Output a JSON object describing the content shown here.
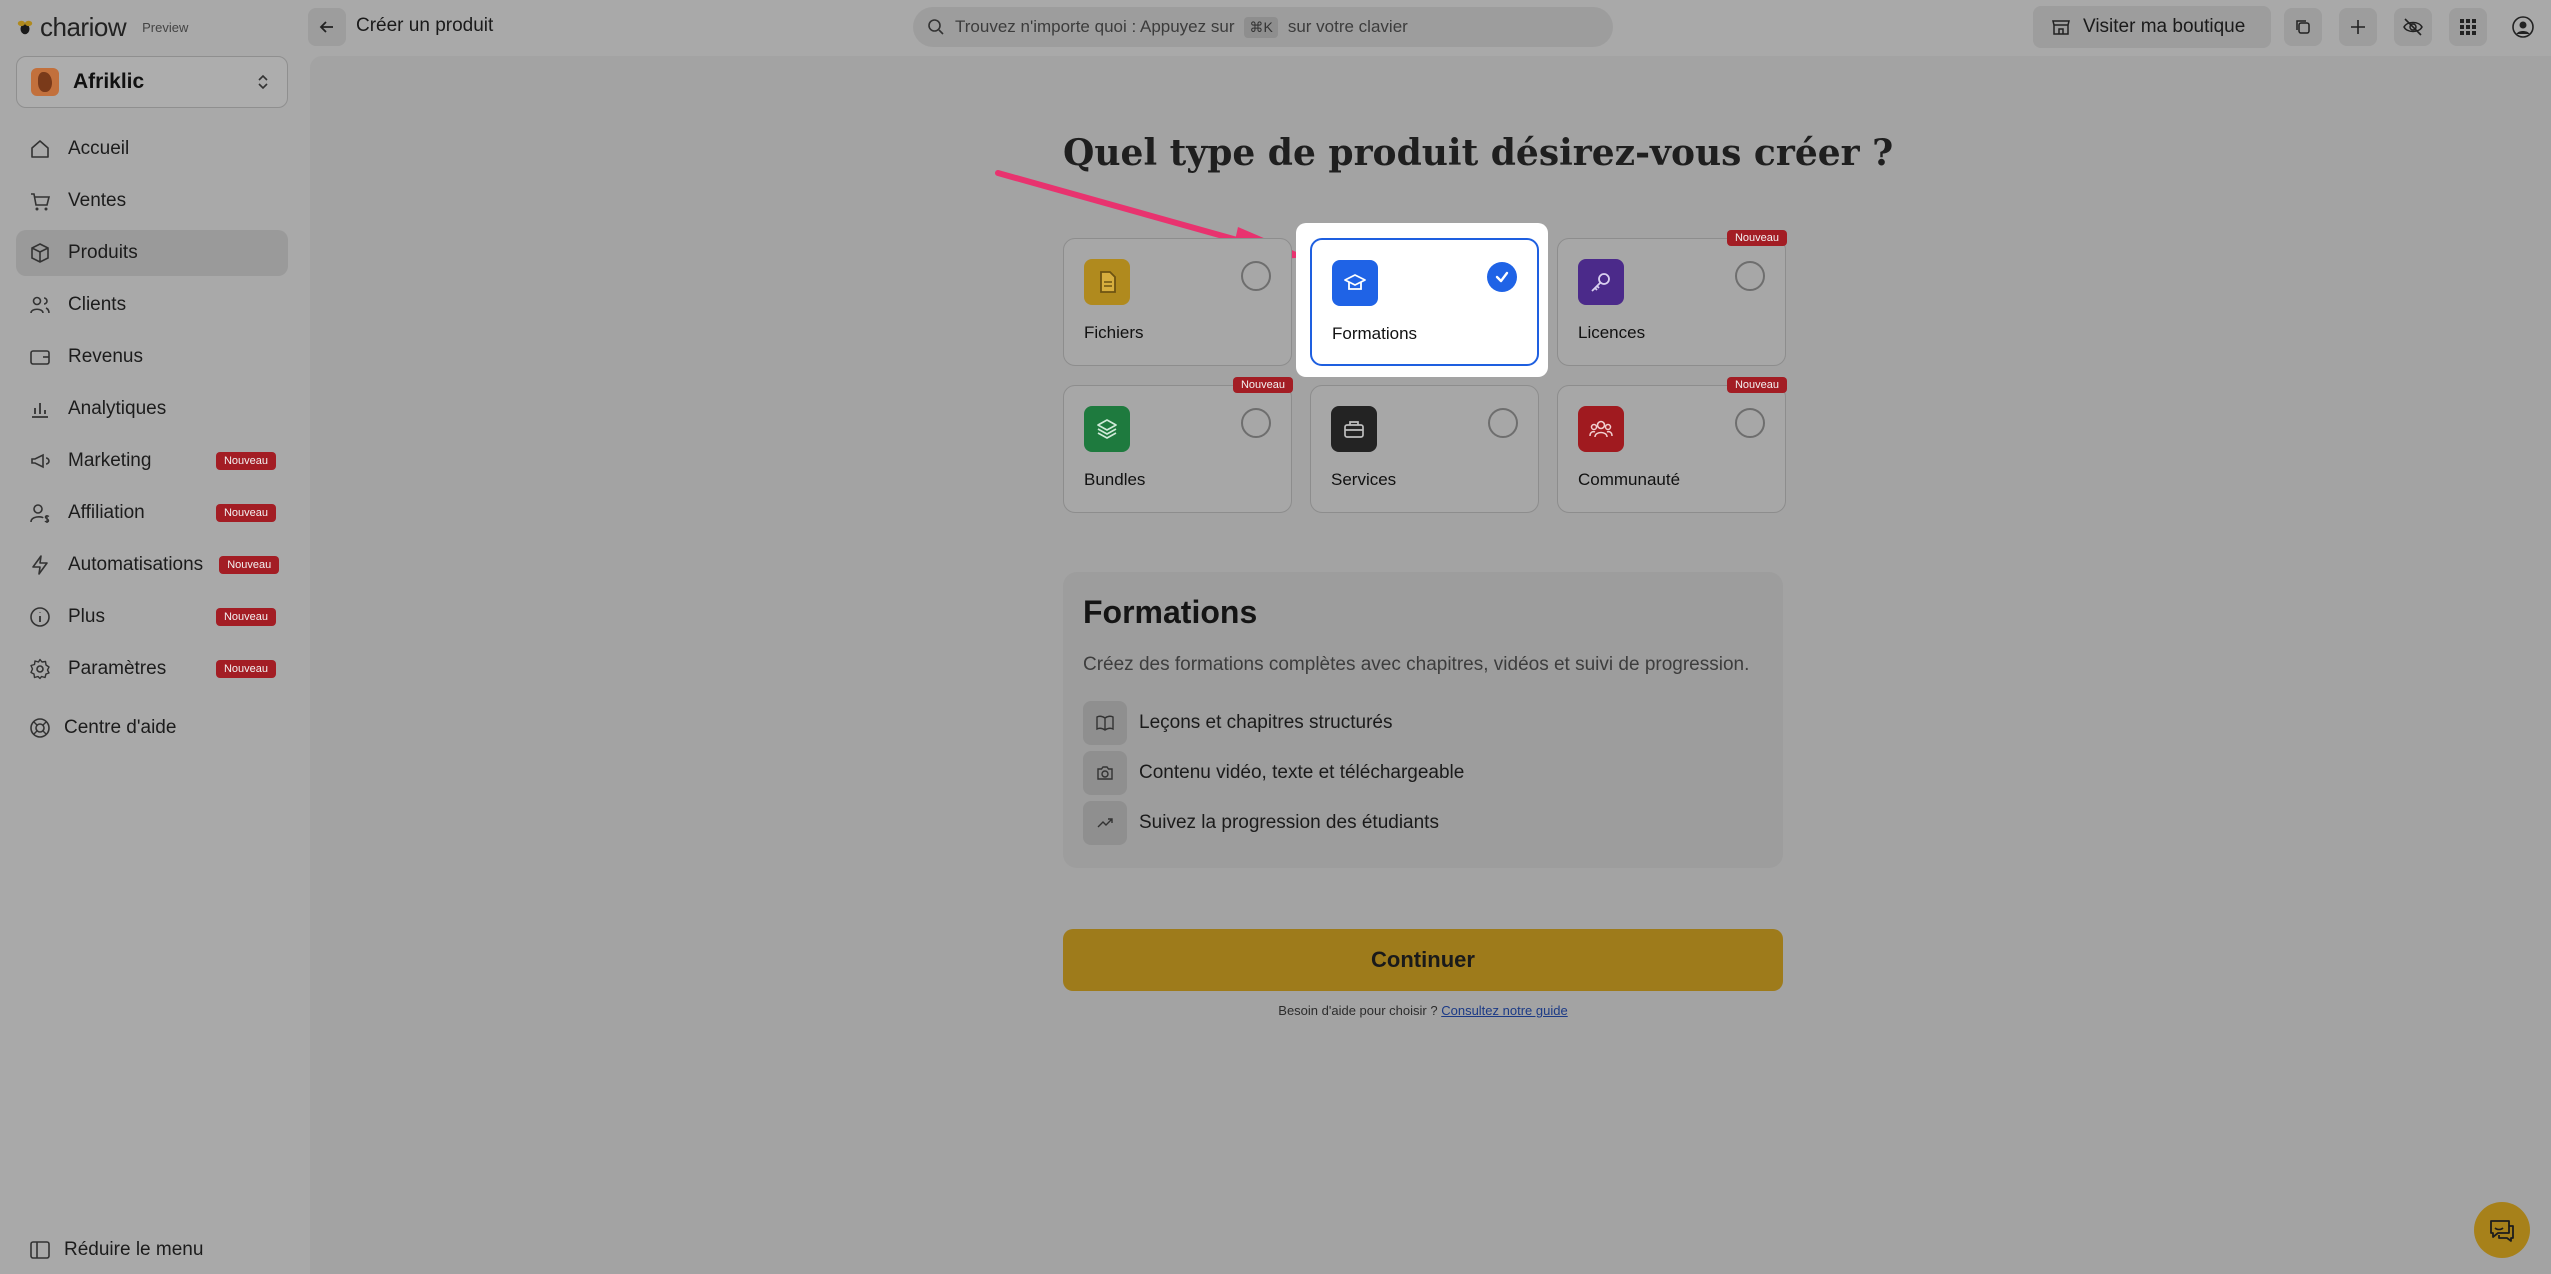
{
  "brand": {
    "name": "chariow",
    "preview": "Preview"
  },
  "workspace": {
    "name": "Afriklic"
  },
  "sidebar": {
    "items": [
      {
        "label": "Accueil",
        "icon": "home-icon",
        "badge": ""
      },
      {
        "label": "Ventes",
        "icon": "cart-icon",
        "badge": ""
      },
      {
        "label": "Produits",
        "icon": "box-icon",
        "badge": ""
      },
      {
        "label": "Clients",
        "icon": "users-icon",
        "badge": ""
      },
      {
        "label": "Revenus",
        "icon": "wallet-icon",
        "badge": ""
      },
      {
        "label": "Analytiques",
        "icon": "chart-icon",
        "badge": ""
      },
      {
        "label": "Marketing",
        "icon": "megaphone-icon",
        "badge": "Nouveau"
      },
      {
        "label": "Affiliation",
        "icon": "user-dollar-icon",
        "badge": "Nouveau"
      },
      {
        "label": "Automatisations",
        "icon": "bolt-icon",
        "badge": "Nouveau"
      },
      {
        "label": "Plus",
        "icon": "info-icon",
        "badge": "Nouveau"
      },
      {
        "label": "Paramètres",
        "icon": "gear-icon",
        "badge": "Nouveau"
      }
    ],
    "help": "Centre d'aide",
    "collapse": "Réduire le menu"
  },
  "topbar": {
    "page_title": "Créer un produit",
    "search_placeholder_before": "Trouvez n'importe quoi : Appuyez sur",
    "search_shortcut": "⌘K",
    "search_placeholder_after": "sur votre clavier",
    "visit_store": "Visiter ma boutique"
  },
  "main": {
    "question": "Quel type de produit désirez-vous créer ?",
    "product_types": [
      {
        "label": "Fichiers",
        "icon": "file-icon",
        "color": "#b08a1e",
        "selected": false,
        "badge": ""
      },
      {
        "label": "Formations",
        "icon": "graduation-icon",
        "color": "#1f63e6",
        "selected": true,
        "badge": ""
      },
      {
        "label": "Licences",
        "icon": "key-icon",
        "color": "#4b2a8a",
        "selected": false,
        "badge": "Nouveau"
      },
      {
        "label": "Bundles",
        "icon": "layers-icon",
        "color": "#1e7a3e",
        "selected": false,
        "badge": "Nouveau"
      },
      {
        "label": "Services",
        "icon": "briefcase-icon",
        "color": "#232323",
        "selected": false,
        "badge": ""
      },
      {
        "label": "Communauté",
        "icon": "community-icon",
        "color": "#a01a1f",
        "selected": false,
        "badge": "Nouveau"
      }
    ],
    "details": {
      "title": "Formations",
      "description": "Créez des formations complètes avec chapitres, vidéos et suivi de progression.",
      "features": [
        {
          "label": "Leçons et chapitres structurés",
          "icon": "book-icon"
        },
        {
          "label": "Contenu vidéo, texte et téléchargeable",
          "icon": "camera-icon"
        },
        {
          "label": "Suivez la progression des étudiants",
          "icon": "trending-up-icon"
        }
      ]
    },
    "continue_label": "Continuer",
    "help_text": "Besoin d'aide pour choisir ?",
    "help_link": "Consultez notre guide"
  },
  "colors": {
    "accent": "#1f63e6",
    "cta": "#9e7b1b",
    "badge": "#a31d24",
    "annotation_arrow": "#e8336f"
  }
}
